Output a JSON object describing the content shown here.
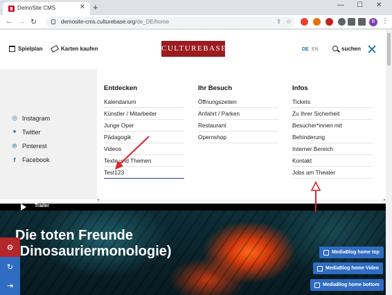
{
  "browser": {
    "tab_title": "DemoSite CMS",
    "tab_close": "✕",
    "new_tab": "+",
    "window_controls": {
      "minimize": "—",
      "maximize": "☐",
      "close": "✕"
    },
    "nav": {
      "back": "←",
      "forward": "→",
      "reload": "↻"
    },
    "url_host": "demosite-cms.culturebase.org",
    "url_path": "/de_DE/home",
    "profile_initial": "B",
    "extension_colors": [
      "#ea4335",
      "#e8710a",
      "#c5221f",
      "#5f6368",
      "#5f6368"
    ]
  },
  "header": {
    "spielplan": "Spielplan",
    "karten": "Karten kaufen",
    "logo": "CULTUREBASE",
    "lang_de": "DE",
    "lang_en": "EN",
    "search": "suchen",
    "close": "✕"
  },
  "social": [
    "Instagram",
    "Twitter",
    "Pinterest",
    "Facebook"
  ],
  "menu": {
    "entdecken": {
      "heading": "Entdecken",
      "items": [
        "Kalendarium",
        "Künstler / Mitarbeiter",
        "Junge Oper",
        "Pädagogik",
        "Videos",
        "Texte und Themen",
        "Test123"
      ]
    },
    "besuch": {
      "heading": "Ihr Besuch",
      "items": [
        "Öffnungszeiten",
        "Anfahrt / Parken",
        "Restaurant",
        "Opernshop"
      ]
    },
    "infos": {
      "heading": "Infos",
      "items": [
        "Tickets",
        "Zu Ihrer Sicherheit",
        "Besucher*innen mit",
        "Behinderung",
        "Interner Bereich",
        "Kontakt",
        "Jobs am Theater"
      ]
    }
  },
  "hero": {
    "trailer": "Trailer",
    "title_line1": "Die toten Freunde",
    "title_line2": "(Dinosauriermonologie)",
    "buttons": [
      "MediaBlog home top",
      "MediaBlog home Video",
      "MediaBlog home bottom"
    ]
  },
  "colors": {
    "logo_bg": "#9b1b1e",
    "accent_blue": "#1d6fa5",
    "media_btn": "#2f6cc2",
    "annotation_red": "#e0202a"
  }
}
